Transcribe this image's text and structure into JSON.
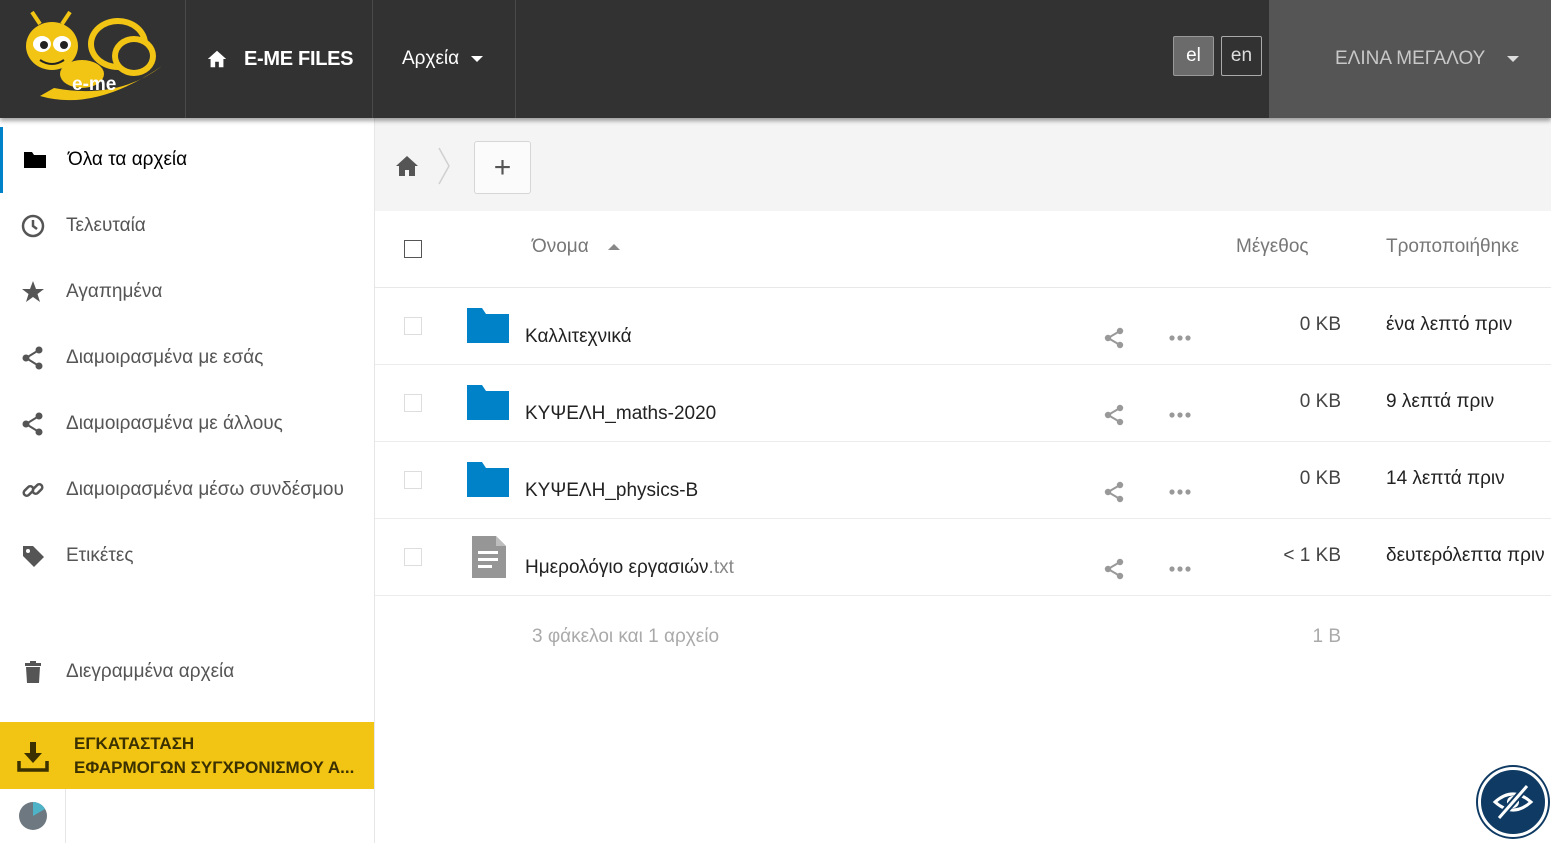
{
  "header": {
    "logo_text": "e-me",
    "app_name": "E-ME FILES",
    "files_menu_label": "Αρχεία",
    "languages": [
      "el",
      "en"
    ],
    "active_language": "el",
    "user_name": "ΕΛΙΝΑ ΜΕΓΑΛΟΥ"
  },
  "sidebar": {
    "items": [
      {
        "label": "Όλα τα αρχεία",
        "icon": "folder-icon",
        "active": true
      },
      {
        "label": "Τελευταία",
        "icon": "clock-icon"
      },
      {
        "label": "Αγαπημένα",
        "icon": "star-icon"
      },
      {
        "label": "Διαμοιρασμένα με εσάς",
        "icon": "share-icon"
      },
      {
        "label": "Διαμοιρασμένα με άλλους",
        "icon": "share-icon"
      },
      {
        "label": "Διαμοιρασμένα μέσω συνδέσμου",
        "icon": "link-icon"
      },
      {
        "label": "Ετικέτες",
        "icon": "tag-icon"
      }
    ],
    "trash_label": "Διεγραμμένα αρχεία",
    "sync_banner": {
      "line1": "ΕΓΚΑΤΑΣΤΑΣΗ",
      "line2": "ΕΦΑΡΜΟΓΩΝ ΣΥΓΧΡΟΝΙΣΜΟΥ Α..."
    }
  },
  "controls": {
    "add_label": "+"
  },
  "table": {
    "columns": {
      "name": "Όνομα",
      "size": "Μέγεθος",
      "modified": "Τροποποιήθηκε"
    },
    "rows": [
      {
        "name": "Καλλιτεχνικά",
        "ext": "",
        "type": "folder",
        "size": "0 KB",
        "modified": "ένα λεπτό πριν"
      },
      {
        "name": "ΚΥΨΕΛΗ_maths-2020",
        "ext": "",
        "type": "folder",
        "size": "0 KB",
        "modified": "9 λεπτά πριν"
      },
      {
        "name": "ΚΥΨΕΛΗ_physics-B",
        "ext": "",
        "type": "folder",
        "size": "0 KB",
        "modified": "14 λεπτά πριν"
      },
      {
        "name": "Ημερολόγιο εργασιών",
        "ext": ".txt",
        "type": "text-file",
        "size": "< 1 KB",
        "modified": "δευτερόλεπτα πριν"
      }
    ],
    "summary": {
      "count": "3 φάκελοι και 1 αρχείο",
      "total_size": "1 B"
    }
  },
  "colors": {
    "header_bg": "#323232",
    "user_menu_bg": "#555555",
    "accent_blue": "#0082c9",
    "sync_banner_bg": "#f2c413",
    "a11y_button_bg": "#0e3a63"
  }
}
